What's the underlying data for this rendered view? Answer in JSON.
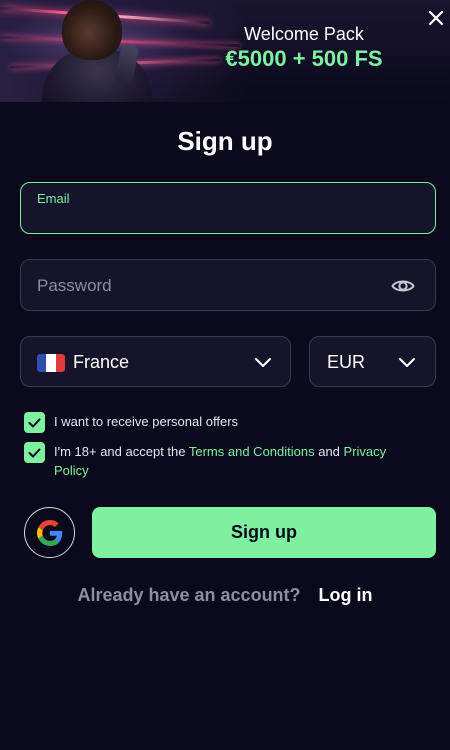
{
  "banner": {
    "title": "Welcome Pack",
    "offer": "€5000 + 500 FS"
  },
  "icons": {
    "close": "close-icon",
    "eye": "eye-icon",
    "chevron": "chevron-down-icon",
    "check": "check-icon",
    "google": "google-icon",
    "flag": "flag-france-icon"
  },
  "form": {
    "title": "Sign up",
    "email": {
      "label": "Email",
      "value": ""
    },
    "password": {
      "placeholder": "Password",
      "value": ""
    },
    "country": {
      "selected": "France"
    },
    "currency": {
      "selected": "EUR"
    },
    "offers_checkbox": {
      "checked": true,
      "label": "I want to receive personal offers"
    },
    "terms_checkbox": {
      "checked": true,
      "prefix": "I'm 18+ and accept the ",
      "terms_link": "Terms and Conditions",
      "middle": " and ",
      "privacy_link": "Privacy Policy"
    },
    "submit_label": "Sign up"
  },
  "footer": {
    "question": "Already have an account?",
    "login_label": "Log in"
  },
  "colors": {
    "background": "#0b0a1c",
    "accent": "#7ef0a0",
    "field": "#16142b",
    "muted": "#8e8da3"
  }
}
